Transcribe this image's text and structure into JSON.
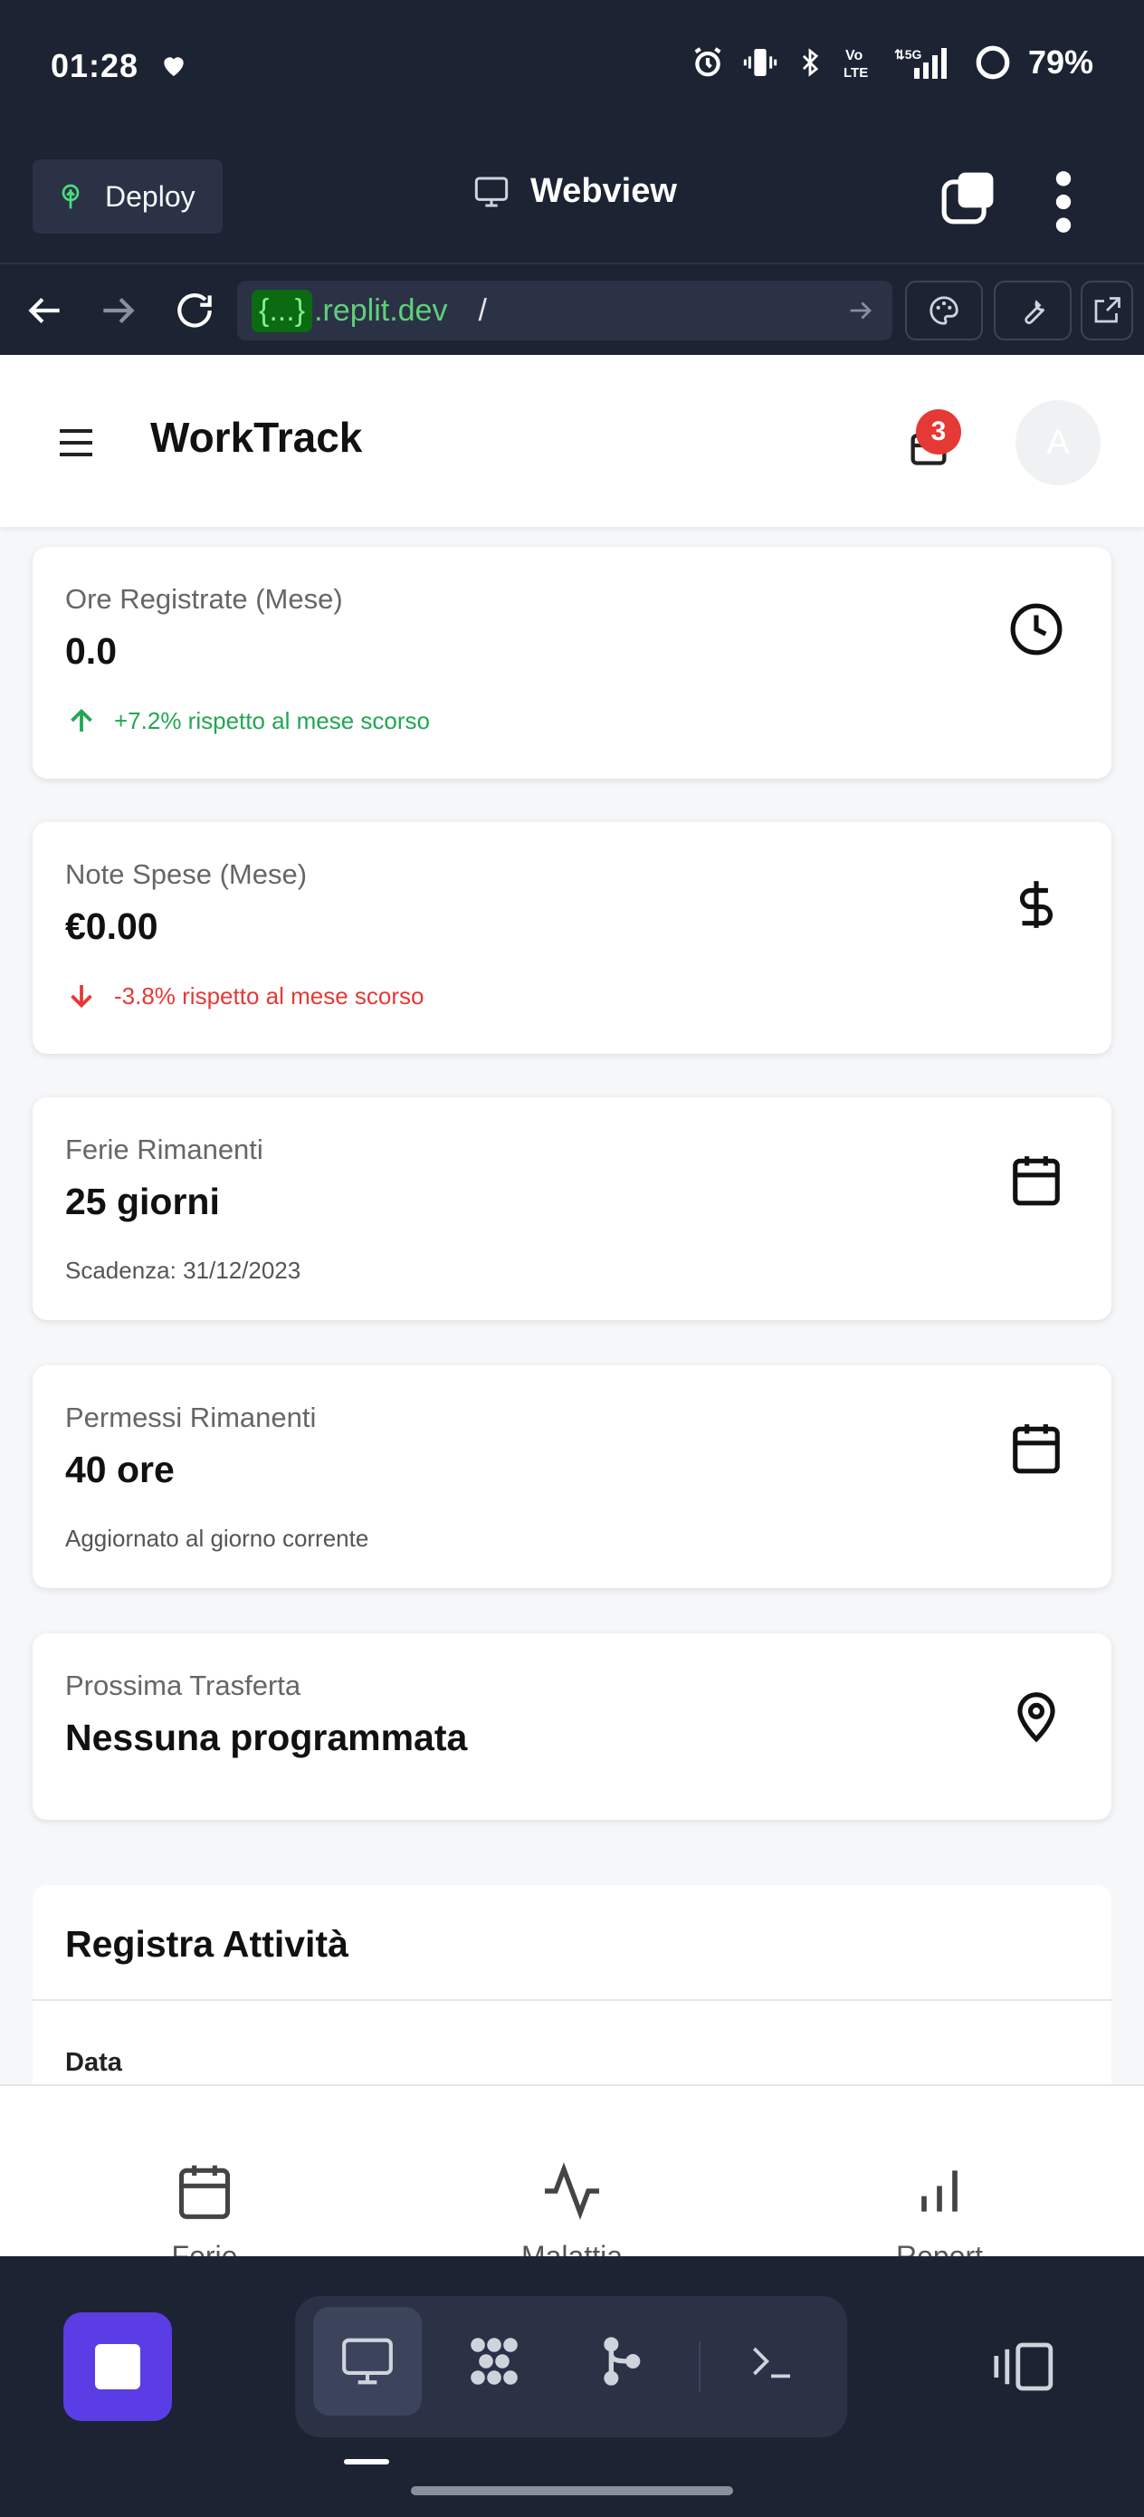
{
  "status_bar": {
    "time": "01:28",
    "battery": "79%",
    "network": "5G",
    "volte": "Vo LTE"
  },
  "replit": {
    "deploy_label": "Deploy",
    "view_title": "Webview",
    "url_badge": "{...}",
    "url_host": ".replit.dev",
    "url_path": "/"
  },
  "app": {
    "title": "WorkTrack",
    "notification_count": "3",
    "avatar_initial": "A",
    "cards": [
      {
        "label": "Ore Registrate (Mese)",
        "value": "0.0",
        "sub": "+7.2% rispetto al mese scorso",
        "trend": "up",
        "icon": "clock-icon"
      },
      {
        "label": "Note Spese (Mese)",
        "value": "€0.00",
        "sub": "-3.8% rispetto al mese scorso",
        "trend": "down",
        "icon": "dollar-icon"
      },
      {
        "label": "Ferie Rimanenti",
        "value": "25 giorni",
        "sub": "Scadenza: 31/12/2023",
        "icon": "calendar-icon"
      },
      {
        "label": "Permessi Rimanenti",
        "value": "40 ore",
        "sub": "Aggiornato al giorno corrente",
        "icon": "calendar-icon"
      },
      {
        "label": "Prossima Trasferta",
        "value": "Nessuna programmata",
        "icon": "map-pin-icon"
      }
    ],
    "section": {
      "title": "Registra Attività",
      "field_label": "Data"
    },
    "bottom_nav": [
      {
        "label": "Ferie",
        "icon": "calendar-icon"
      },
      {
        "label": "Malattia",
        "icon": "activity-icon"
      },
      {
        "label": "Report",
        "icon": "bar-chart-icon"
      }
    ]
  },
  "colors": {
    "accent": "#5b3de6",
    "up": "#22a652",
    "down": "#e53935",
    "ide_bg": "#1c2333"
  }
}
